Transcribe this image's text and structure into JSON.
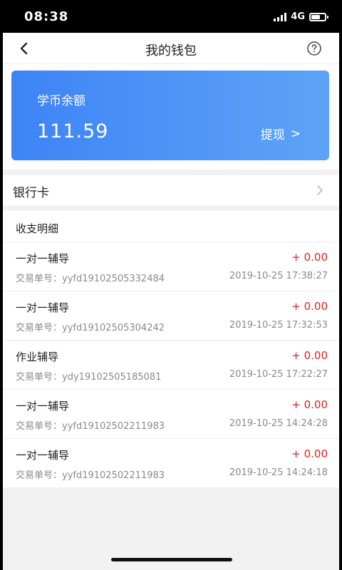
{
  "status_bar": {
    "time": "08:38",
    "network": "4G"
  },
  "nav": {
    "title": "我的钱包"
  },
  "balance": {
    "label": "学币余额",
    "value": "111.59",
    "withdraw_label": "提现",
    "withdraw_arrow": ">"
  },
  "bank_card": {
    "label": "银行卡"
  },
  "details": {
    "title": "收支明细",
    "transactions": [
      {
        "name": "一对一辅导",
        "amount": "+ 0.00",
        "order_no": "交易单号：yyfd19102505332484",
        "time": "2019-10-25 17:38:27"
      },
      {
        "name": "一对一辅导",
        "amount": "+ 0.00",
        "order_no": "交易单号：yyfd19102505304242",
        "time": "2019-10-25 17:32:53"
      },
      {
        "name": "作业辅导",
        "amount": "+ 0.00",
        "order_no": "交易单号：ydy19102505185081",
        "time": "2019-10-25 17:22:27"
      },
      {
        "name": "一对一辅导",
        "amount": "+ 0.00",
        "order_no": "交易单号：yyfd19102502211983",
        "time": "2019-10-25 14:24:28"
      },
      {
        "name": "一对一辅导",
        "amount": "+ 0.00",
        "order_no": "交易单号：yyfd19102502211983",
        "time": "2019-10-25 14:24:18"
      }
    ]
  },
  "colors": {
    "card_start": "#3d84f6",
    "card_end": "#5ea3f7",
    "amount": "#e02020",
    "background": "#f2f2f2"
  },
  "icons": {
    "back": "back-arrow-icon",
    "help": "help-circle-icon",
    "bank_chevron": "chevron-right-icon",
    "battery": "battery-icon",
    "signal": "signal-icon"
  }
}
